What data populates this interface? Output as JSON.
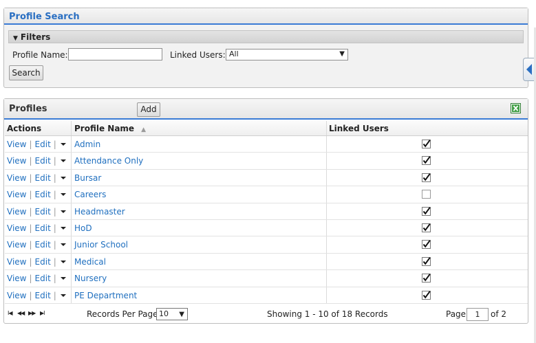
{
  "search": {
    "title": "Profile Search",
    "filters_label": "Filters",
    "profile_name_label": "Profile Name:",
    "profile_name_value": "",
    "linked_users_label": "Linked Users:",
    "linked_users_value": "All",
    "search_button": "Search"
  },
  "profiles": {
    "title": "Profiles",
    "add_button": "Add",
    "columns": {
      "actions": "Actions",
      "profile_name": "Profile Name",
      "linked_users": "Linked Users"
    },
    "view_label": "View",
    "edit_label": "Edit",
    "rows": [
      {
        "name": "Admin",
        "linked": true
      },
      {
        "name": "Attendance Only",
        "linked": true
      },
      {
        "name": "Bursar",
        "linked": true
      },
      {
        "name": "Careers",
        "linked": false
      },
      {
        "name": "Headmaster",
        "linked": true
      },
      {
        "name": "HoD",
        "linked": true
      },
      {
        "name": "Junior School",
        "linked": true
      },
      {
        "name": "Medical",
        "linked": true
      },
      {
        "name": "Nursery",
        "linked": true
      },
      {
        "name": "PE Department",
        "linked": true
      }
    ]
  },
  "pager": {
    "records_per_page_label": "Records Per Page",
    "records_per_page_value": "10",
    "showing_text": "Showing 1 - 10 of 18 Records",
    "page_label": "Page",
    "page_value": "1",
    "page_total": "of 2"
  },
  "colors": {
    "accent": "#2a6fc2",
    "link": "#1f6fbf"
  }
}
